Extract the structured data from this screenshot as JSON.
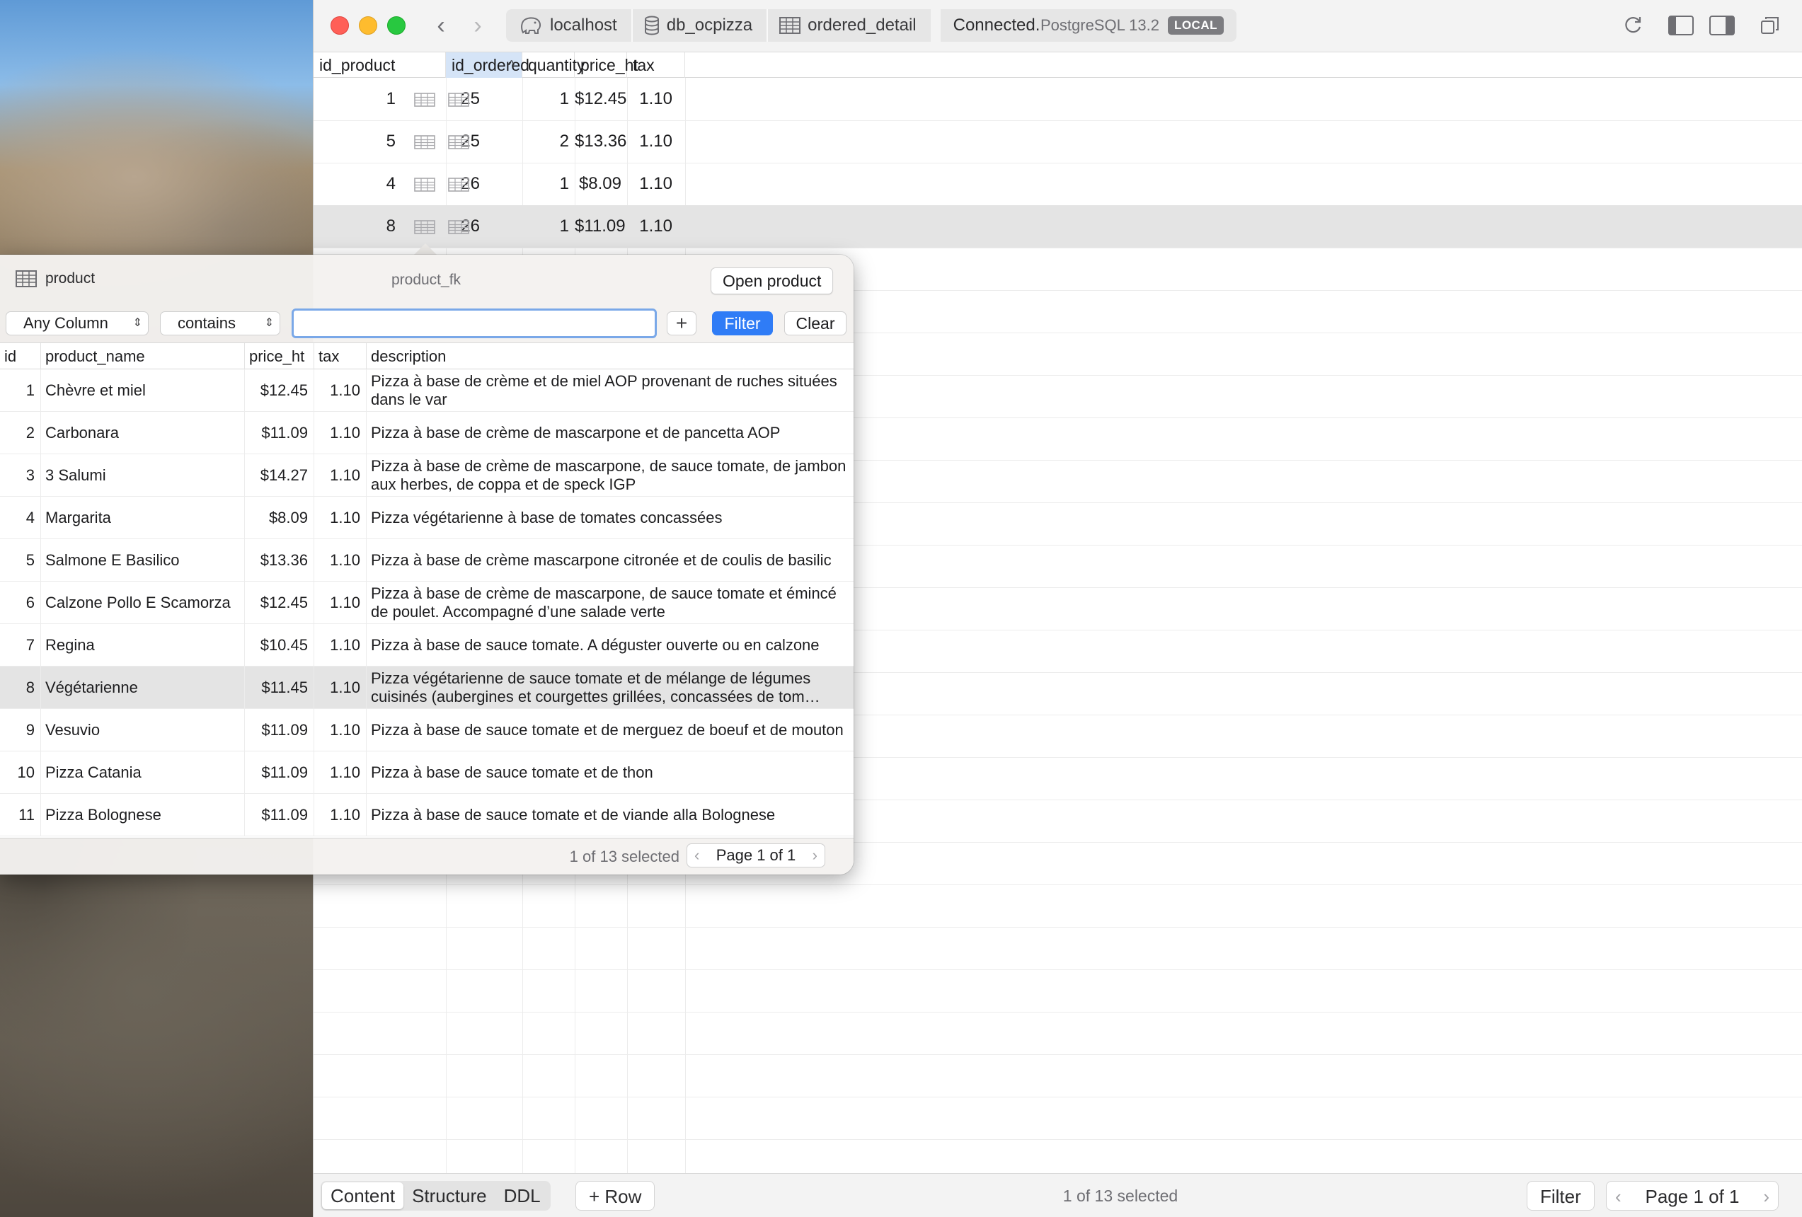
{
  "titlebar": {
    "breadcrumb": [
      {
        "label": "localhost",
        "icon": "elephant-icon"
      },
      {
        "label": "db_ocpizza",
        "icon": "database-icon"
      },
      {
        "label": "ordered_detail",
        "icon": "table-icon"
      }
    ],
    "status": "Connected.",
    "db_version": "PostgreSQL 13.2",
    "badge": "LOCAL"
  },
  "main_table": {
    "columns": [
      "id_product",
      "id_ordered",
      "quantity",
      "price_ht",
      "tax"
    ],
    "sorted_column": "id_ordered",
    "rows": [
      {
        "id_product": "1",
        "id_ordered": "25",
        "quantity": "1",
        "price_ht": "$12.45",
        "tax": "1.10"
      },
      {
        "id_product": "5",
        "id_ordered": "25",
        "quantity": "2",
        "price_ht": "$13.36",
        "tax": "1.10"
      },
      {
        "id_product": "4",
        "id_ordered": "26",
        "quantity": "1",
        "price_ht": "$8.09",
        "tax": "1.10"
      },
      {
        "id_product": "8",
        "id_ordered": "26",
        "quantity": "1",
        "price_ht": "$11.09",
        "tax": "1.10"
      }
    ],
    "selected_row": 3
  },
  "popover": {
    "table_name": "product",
    "fk_name": "product_fk",
    "open_button": "Open product",
    "filter": {
      "column": "Any Column",
      "operator": "contains",
      "value": "",
      "add_label": "+",
      "filter_label": "Filter",
      "clear_label": "Clear"
    },
    "columns": [
      "id",
      "product_name",
      "price_ht",
      "tax",
      "description"
    ],
    "rows": [
      {
        "id": "1",
        "product_name": "Chèvre et miel",
        "price_ht": "$12.45",
        "tax": "1.10",
        "description": "Pizza à base de crème et de miel AOP provenant de ruches situées dans le var"
      },
      {
        "id": "2",
        "product_name": "Carbonara",
        "price_ht": "$11.09",
        "tax": "1.10",
        "description": "Pizza à base de crème de mascarpone et de pancetta AOP"
      },
      {
        "id": "3",
        "product_name": "3 Salumi",
        "price_ht": "$14.27",
        "tax": "1.10",
        "description": "Pizza à base de crème de mascarpone, de sauce tomate, de jambon aux herbes, de coppa et de speck IGP"
      },
      {
        "id": "4",
        "product_name": "Margarita",
        "price_ht": "$8.09",
        "tax": "1.10",
        "description": "Pizza végétarienne à base de tomates concassées"
      },
      {
        "id": "5",
        "product_name": "Salmone E Basilico",
        "price_ht": "$13.36",
        "tax": "1.10",
        "description": "Pizza à base de crème mascarpone citronée et de coulis de basilic"
      },
      {
        "id": "6",
        "product_name": "Calzone Pollo E Scamorza",
        "price_ht": "$12.45",
        "tax": "1.10",
        "description": "Pizza à base de crème de mascarpone, de sauce tomate et émincé de poulet. Accompagné d’une salade verte"
      },
      {
        "id": "7",
        "product_name": "Regina",
        "price_ht": "$10.45",
        "tax": "1.10",
        "description": "Pizza à base de sauce tomate. A déguster ouverte ou en calzone"
      },
      {
        "id": "8",
        "product_name": "Végétarienne",
        "price_ht": "$11.45",
        "tax": "1.10",
        "description": "Pizza végétarienne de sauce tomate et de mélange de légumes cuisinés (aubergines et courgettes grillées, concassées de tom…"
      },
      {
        "id": "9",
        "product_name": "Vesuvio",
        "price_ht": "$11.09",
        "tax": "1.10",
        "description": "Pizza à base de sauce tomate et de merguez de boeuf et de mouton"
      },
      {
        "id": "10",
        "product_name": "Pizza Catania",
        "price_ht": "$11.09",
        "tax": "1.10",
        "description": "Pizza à base de sauce tomate et de thon"
      },
      {
        "id": "11",
        "product_name": "Pizza Bolognese",
        "price_ht": "$11.09",
        "tax": "1.10",
        "description": "Pizza à base de sauce tomate et de viande alla Bolognese"
      }
    ],
    "selected_row": 7,
    "footer": {
      "status": "1 of 13 selected",
      "page": "Page 1 of 1"
    }
  },
  "bottombar": {
    "tabs": [
      "Content",
      "Structure",
      "DDL"
    ],
    "active_tab": "Content",
    "add_row": "+ Row",
    "status": "1 of 13 selected",
    "filter": "Filter",
    "page": "Page 1 of 1"
  },
  "colors": {
    "accent": "#2f7cf6",
    "selected_row": "#e4e4e4",
    "sorted_header": "#d5e4f7"
  }
}
